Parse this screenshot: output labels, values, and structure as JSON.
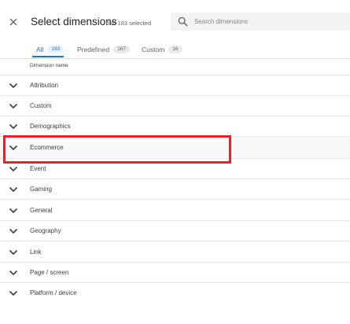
{
  "header": {
    "title": "Select dimensions",
    "selected_count": "0 of 183 selected"
  },
  "search": {
    "placeholder": "Search dimensions",
    "value": ""
  },
  "tabs": [
    {
      "label": "All",
      "count": "183",
      "active": true
    },
    {
      "label": "Predefined",
      "count": "167",
      "active": false
    },
    {
      "label": "Custom",
      "count": "16",
      "active": false
    }
  ],
  "table": {
    "column_header": "Dimension name"
  },
  "rows": [
    {
      "label": "Attribution"
    },
    {
      "label": "Custom"
    },
    {
      "label": "Demographics"
    },
    {
      "label": "Ecommerce",
      "highlighted": true
    },
    {
      "label": "Event"
    },
    {
      "label": "Gaming"
    },
    {
      "label": "General"
    },
    {
      "label": "Geography"
    },
    {
      "label": "Link"
    },
    {
      "label": "Page / screen"
    },
    {
      "label": "Platform / device"
    }
  ],
  "colors": {
    "accent": "#1a73e8",
    "highlight_box": "#e0252b"
  },
  "icons": {
    "close": "close-icon",
    "search": "search-icon",
    "expand": "chevron-down-icon"
  }
}
